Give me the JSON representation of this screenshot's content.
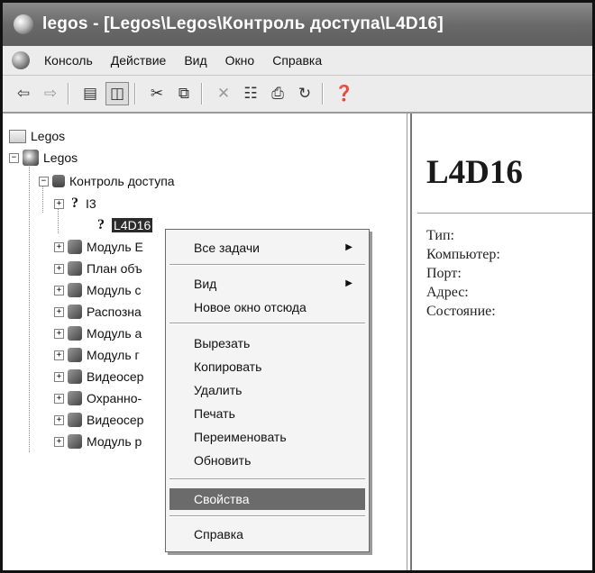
{
  "window": {
    "title": "legos - [Legos\\Legos\\Контроль доступа\\L4D16]"
  },
  "menubar": {
    "items": [
      "Консоль",
      "Действие",
      "Вид",
      "Окно",
      "Справка"
    ]
  },
  "toolbar": {
    "icons": [
      "back-icon",
      "forward-icon",
      "up-folder-icon",
      "show-hide-tree-icon",
      "cut-icon",
      "copy-icon",
      "delete-icon",
      "properties-icon",
      "print-icon",
      "refresh-icon",
      "help-icon"
    ]
  },
  "tree": {
    "root": "Legos",
    "app": "Legos",
    "access_control": "Контроль доступа",
    "child_i3": "I3",
    "child_l4d16": "L4D16",
    "modules": [
      {
        "label": "Модуль Е",
        "icon": "module-icon"
      },
      {
        "label": "План объ",
        "icon": "plan-icon"
      },
      {
        "label": "Модуль с",
        "icon": "module-icon"
      },
      {
        "label": "Распозна",
        "icon": "recognition-icon"
      },
      {
        "label": "Модуль а",
        "icon": "module-icon"
      },
      {
        "label": "Модуль г",
        "icon": "module-icon"
      },
      {
        "label": "Видеосер",
        "icon": "video-server-icon"
      },
      {
        "label": "Охранно-",
        "icon": "security-icon"
      },
      {
        "label": "Видеосер",
        "icon": "video-server-icon"
      },
      {
        "label": "Модуль р",
        "icon": "module-icon"
      }
    ]
  },
  "context_menu": {
    "all_tasks": "Все задачи",
    "view": "Вид",
    "new_window": "Новое окно отсюда",
    "cut": "Вырезать",
    "copy": "Копировать",
    "delete": "Удалить",
    "print": "Печать",
    "rename": "Переименовать",
    "refresh": "Обновить",
    "properties": "Свойства",
    "help": "Справка"
  },
  "details": {
    "title": "L4D16",
    "fields": [
      "Тип:",
      "Компьютер:",
      "Порт:",
      "Адрес:",
      "Состояние:"
    ]
  }
}
